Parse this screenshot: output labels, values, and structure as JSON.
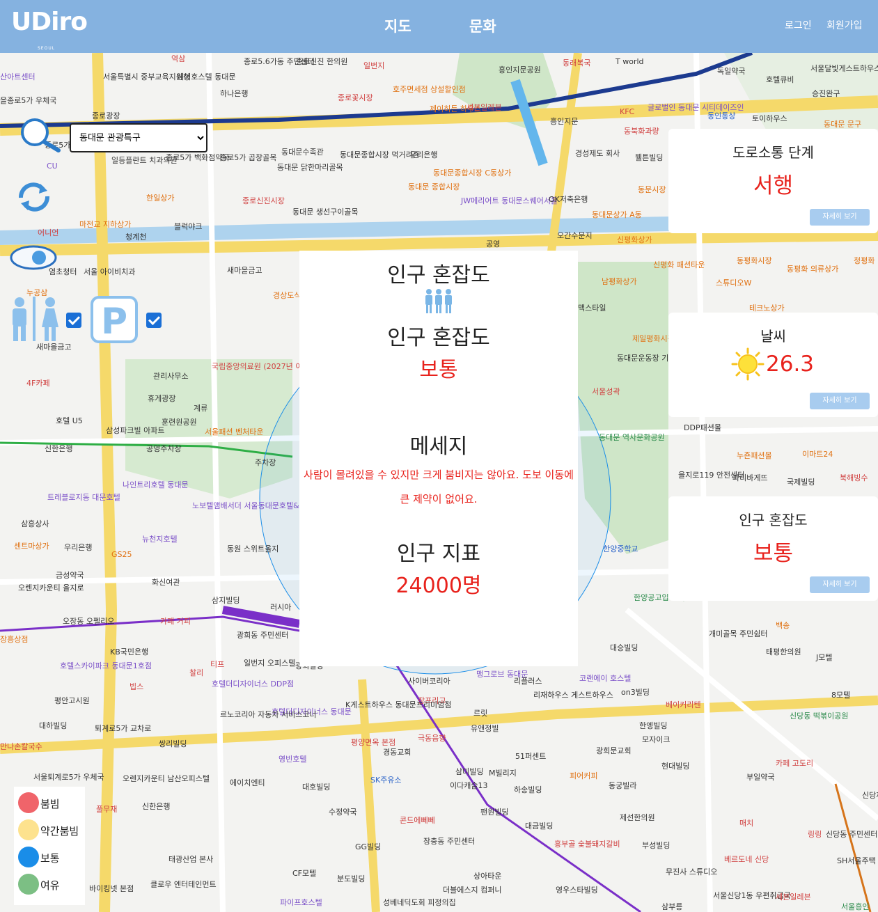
{
  "header": {
    "logo": "UDiro",
    "logo_subtitle": "SEOUL",
    "nav": [
      "지도",
      "문화"
    ],
    "login": "로그인",
    "signup": "회원가입"
  },
  "controls": {
    "district_selected": "동대문 관광특구",
    "district_options": [
      "동대문 관광특구"
    ],
    "restroom_checked": true,
    "parking_checked": true
  },
  "center_panel": {
    "heading": "인구 혼잡도",
    "congestion_label": "인구 혼잡도",
    "congestion_value": "보통",
    "message_title": "메세지",
    "message": "사람이 몰려있을 수 있지만 크게 붐비지는 않아요. 도보 이동에 큰 제약이 없어요.",
    "population_title": "인구 지표",
    "population_value": "24000명"
  },
  "cards": {
    "traffic": {
      "title": "도로소통 단계",
      "value": "서행",
      "button": "자세히 보기"
    },
    "weather": {
      "title": "날씨",
      "value": "26.3",
      "button": "자세히 보기",
      "icon": "sun-icon"
    },
    "congestion": {
      "title": "인구 혼잡도",
      "value": "보통",
      "button": "자세히 보기"
    }
  },
  "legend": [
    {
      "label": "붐빔",
      "color": "#f0646a"
    },
    {
      "label": "약간붐빔",
      "color": "#fde28e"
    },
    {
      "label": "보통",
      "color": "#1a8de8"
    },
    {
      "label": "여유",
      "color": "#7cbf84"
    }
  ],
  "map_labels": {
    "l1": "종로5.6가동 주민센터",
    "l2": "종로신진 한의원",
    "l3": "일번지",
    "l4": "동래복국",
    "l5": "T world",
    "l6": "서울특별시 중부교육지원청",
    "l7": "에어호스텔 동대문",
    "l8": "하나은행",
    "l9": "종로꽃시장",
    "l10": "호주면세점 상설할인점",
    "l11": "흥인지문공원",
    "l12": "독일약국",
    "l13": "서울달빛게스트하우스 동대문",
    "l14": "호텔큐비",
    "l15": "승진완구",
    "l16": "종로광장",
    "l17": "제이히든 하우스",
    "l18": "세븐일레븐",
    "l19": "흥인지문",
    "l20": "KFC",
    "l21": "글로벌인 동대문 시티데이즈인",
    "l22": "동인통상",
    "l23": "토이하우스",
    "l24": "동대문 문구",
    "l25": "일등플란트 치과의원",
    "l26": "종로5가 백화점약국",
    "l27": "종로5가 곱창골목",
    "l28": "동대문수족관",
    "l29": "동대문종합시장 먹거리존",
    "l30": "우리은행",
    "l31": "동대문종합시장 C동상가",
    "l32": "동대문 종합시장",
    "l33": "JW메리어트 동대문스퀘어서울",
    "l34": "경성제도 회사",
    "l35": "웰튼빌딩",
    "l36": "동북화과량",
    "l37": "동문시장",
    "l38": "한일상가",
    "l39": "종로신진시장",
    "l40": "동대문 닭한마리골목",
    "l41": "동대문 생선구이골목",
    "l42": "OK저축은행",
    "l43": "동대문상가 A동",
    "l44": "마전교 지하상가",
    "l45": "블럭야크",
    "l46": "청계천",
    "l47": "공영",
    "l48": "오간수문지",
    "l49": "신평화상가",
    "l50": "동평화시장",
    "l51": "동평화 의류상가",
    "l52": "청평화",
    "l53": "염초청터",
    "l54": "서울 아이비치과",
    "l55": "새마을금고",
    "l56": "경상도식",
    "l57": "누공삼",
    "l58": "신평화 패션타운",
    "l59": "남평화상가",
    "l60": "스튜디오W",
    "l61": "테크노상가",
    "l62": "맥스타일",
    "l63": "제일평화시장",
    "l64": "새마을금고",
    "l65": "4F카페",
    "l66": "관리사무소",
    "l67": "국립중앙의료원 (2027년 이전 예정)",
    "l68": "동대문운동장 기념관",
    "l69": "서울성곽",
    "l70": "휴게광장",
    "l71": "훈련원공원",
    "l72": "계류",
    "l73": "호텔 U5",
    "l74": "삼성파크빌 아파트",
    "l75": "서울패션 벤처타운",
    "l76": "공영주차장",
    "l77": "신한은행",
    "l78": "주차장",
    "l79": "동대문 역사문화공원",
    "l80": "DDP패션몰",
    "l81": "누죤패션몰",
    "l82": "이마트24",
    "l83": "나인트리호텔 동대문",
    "l84": "트레블로지동 대문호텔",
    "l85": "노보텔앰배서더 서울동대문호텔&레지던스",
    "l86": "을지로119 안전센터",
    "l87": "파리바게뜨",
    "l88": "국제빌딩",
    "l89": "북해빙수",
    "l90": "삼흥상사",
    "l91": "뉴천지호텔",
    "l92": "센트마상가",
    "l93": "우리은행",
    "l94": "동원 스위트올지",
    "l95": "한양중학교",
    "l96": "GS25",
    "l97": "금성약국",
    "l98": "오렌지카운티 을지로",
    "l99": "화신여관",
    "l100": "삼지빌딩",
    "l101": "한양공고입 교차로",
    "l102": "오장동 오펠리오",
    "l103": "카페 거피",
    "l104": "러시아",
    "l105": "개미골목 주민쉼터",
    "l106": "백송",
    "l107": "장흥상점",
    "l108": "광희동 주민센터",
    "l109": "KB국민은행",
    "l110": "대승빌딩",
    "l111": "태평한의원",
    "l112": "J모텔",
    "l113": "호텔스카이파크 동대문1호점",
    "l114": "일번지 오피스텔",
    "l115": "찰리",
    "l116": "티프",
    "l117": "광희빌딩",
    "l118": "맹그로브 동대문",
    "l119": "리플러스",
    "l120": "코랜에이 호스텔",
    "l121": "빕스",
    "l122": "호텔더디자이너스 DDP점",
    "l123": "사이버코리아",
    "l124": "평안고시원",
    "l125": "on3빌딩",
    "l126": "8모텔",
    "l127": "장프리고",
    "l128": "K게스트하우스 동대문프리미엄점",
    "l129": "리재하우스 게스트하우스",
    "l130": "호텔더디자이너스 동대문",
    "l131": "르노코리아 자동차 서비스코너",
    "l132": "베이커리텐",
    "l133": "르릿",
    "l134": "한엥빌딩",
    "l135": "대하빌딩",
    "l136": "퇴계로5가 교차로",
    "l137": "평양면옥 본점",
    "l138": "유앤정빌",
    "l139": "모자이크",
    "l140": "신당동 떡볶이공원",
    "l141": "극동음향",
    "l142": "만나손칼국수",
    "l143": "쌍리빌딩",
    "l144": "영빈호텔",
    "l145": "경동교회",
    "l146": "광희문교회",
    "l147": "현대빌딩",
    "l148": "51퍼센트",
    "l149": "부일약국",
    "l150": "카페 고도리",
    "l151": "서울퇴계로5가 우체국",
    "l152": "오렌지카운티 남산오피스텔",
    "l153": "에이치엔티",
    "l154": "대호빌딩",
    "l155": "SK주유소",
    "l156": "삼미빌딩",
    "l157": "M빌리지",
    "l158": "피어커피",
    "l159": "동궁빌라",
    "l160": "이다캐슬13",
    "l161": "하송빌딩",
    "l162": "신당제1",
    "l163": "풀무재",
    "l164": "신한은행",
    "l165": "수정약국",
    "l166": "팬원빌딩",
    "l167": "제선한의원",
    "l168": "매치",
    "l169": "링링",
    "l170": "신당동 주민센터",
    "l171": "콘드에뻬뻬",
    "l172": "대금빌딩",
    "l173": "부성빌딩",
    "l174": "장충동 주민센터",
    "l175": "GG빌딩",
    "l176": "흥부골 숯불돼지갈비",
    "l177": "태광산업 본사",
    "l178": "CF모텔",
    "l179": "분도빌딩",
    "l180": "상아타운",
    "l181": "더블에스지 컴퍼니",
    "l182": "영우스타빌딩",
    "l183": "무진사 스튜디오",
    "l184": "베르도네 신당",
    "l185": "SH서울주택 성동센",
    "l186": "바이킹넷 본점",
    "l187": "클로우 엔터테인먼트",
    "l188": "성베네딕도회 피정의집",
    "l189": "서울신당1동 우편취급국",
    "l190": "세븐일레븐",
    "l191": "서울흥인",
    "l192": "파이프호스텔",
    "l193": "삼부릉",
    "l194": "CU",
    "l195": "산아트센터",
    "l196": "을종로5가 우체국",
    "l197": "종로5가",
    "l198": "역삼",
    "l199": "어니언"
  }
}
